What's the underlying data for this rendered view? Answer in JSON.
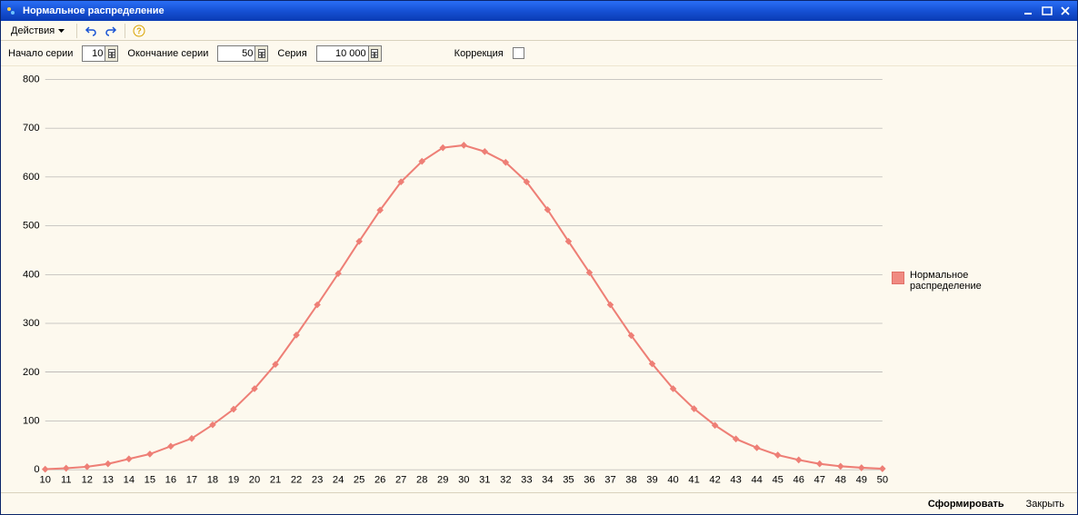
{
  "window": {
    "title": "Нормальное распределение"
  },
  "toolbar": {
    "actions_label": "Действия"
  },
  "params": {
    "start_label": "Начало серии",
    "start_value": "10",
    "end_label": "Окончание серии",
    "end_value": "50",
    "series_label": "Серия",
    "series_value": "10 000",
    "correction_label": "Коррекция",
    "correction_checked": false
  },
  "legend": {
    "series_name": "Нормальное\nраспределение"
  },
  "footer": {
    "form_label": "Сформировать",
    "close_label": "Закрыть"
  },
  "chart_data": {
    "type": "line",
    "title": "",
    "xlabel": "",
    "ylabel": "",
    "ylim": [
      0,
      800
    ],
    "xlim": [
      10,
      50
    ],
    "yticks": [
      0,
      100,
      200,
      300,
      400,
      500,
      600,
      700,
      800
    ],
    "categories": [
      10,
      11,
      12,
      13,
      14,
      15,
      16,
      17,
      18,
      19,
      20,
      21,
      22,
      23,
      24,
      25,
      26,
      27,
      28,
      29,
      30,
      31,
      32,
      33,
      34,
      35,
      36,
      37,
      38,
      39,
      40,
      41,
      42,
      43,
      44,
      45,
      46,
      47,
      48,
      49,
      50
    ],
    "series": [
      {
        "name": "Нормальное распределение",
        "values": [
          1,
          3,
          6,
          12,
          22,
          32,
          48,
          64,
          92,
          124,
          166,
          216,
          276,
          338,
          402,
          468,
          532,
          590,
          632,
          660,
          665,
          652,
          630,
          590,
          533,
          468,
          404,
          338,
          275,
          217,
          166,
          125,
          91,
          63,
          45,
          30,
          20,
          12,
          7,
          4,
          2
        ]
      }
    ],
    "legend_position": "right",
    "grid": true
  }
}
